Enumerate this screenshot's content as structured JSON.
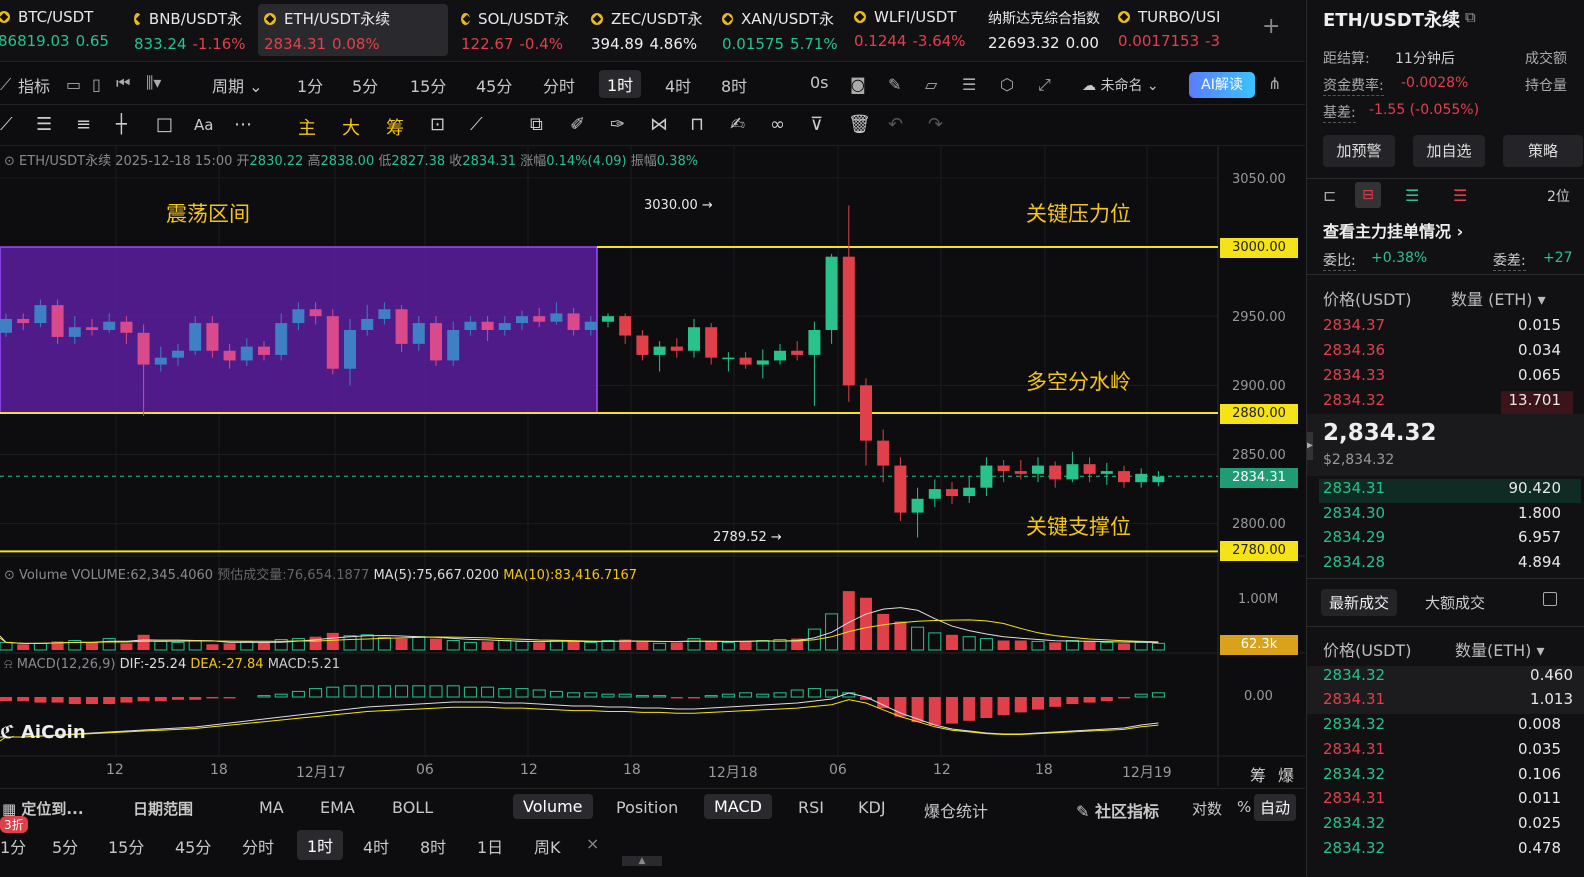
{
  "tickers": [
    {
      "symbol": "BTC/USDT",
      "price": "86819.03",
      "change": "0.65",
      "color": "green"
    },
    {
      "symbol": "BNB/USDT永",
      "price": "833.24",
      "change": "-1.16%",
      "color": "green"
    },
    {
      "symbol": "ETH/USDT永续",
      "price": "2834.31",
      "change": "0.08%",
      "color": "red"
    },
    {
      "symbol": "SOL/USDT永",
      "price": "122.67",
      "change": "-0.4%",
      "color": "red"
    },
    {
      "symbol": "ZEC/USDT永",
      "price": "394.89",
      "change": "4.86%",
      "color": "white"
    },
    {
      "symbol": "XAN/USDT永",
      "price": "0.01575",
      "change": "5.71%",
      "color": "green"
    },
    {
      "symbol": "WLFI/USDT",
      "price": "0.1244",
      "change": "-3.64%",
      "color": "red"
    },
    {
      "symbol": "纳斯达克综合指数",
      "price": "22693.32",
      "change": "0.00",
      "color": "white"
    },
    {
      "symbol": "TURBO/USI",
      "price": "0.0017153",
      "change": "-3",
      "color": "red"
    }
  ],
  "toolbar": {
    "indicators": "指标",
    "period": "周期",
    "intervals": [
      "1分",
      "5分",
      "15分",
      "45分",
      "分时",
      "1时",
      "4时",
      "8时"
    ],
    "selected_interval": "1时",
    "countdown": "0s",
    "layout_name": "未命名",
    "ai_label": "AI解读"
  },
  "drawing_tools": {
    "main": "主",
    "big": "大",
    "chips": "筹"
  },
  "ohlc": {
    "symbol": "ETH/USDT永续",
    "datetime": "2025-12-18 15:00",
    "open_label": "开",
    "open": "2830.22",
    "high_label": "高",
    "high": "2838.00",
    "low_label": "低",
    "low": "2827.38",
    "close_label": "收",
    "close": "2834.31",
    "change_label": "涨幅",
    "change": "0.14%(4.09)",
    "amp_label": "振幅",
    "amp": "0.38%"
  },
  "annotations": {
    "range": "震荡区间",
    "resistance": "关键压力位",
    "watershed": "多空分水岭",
    "support": "关键支撑位",
    "high_mark": "3030.00 →",
    "low_mark": "2789.52 →"
  },
  "price_axis": [
    "3050.00",
    "3000.00",
    "2950.00",
    "2900.00",
    "2880.00",
    "2850.00",
    "2834.31",
    "2800.00",
    "2780.00"
  ],
  "price_tags": {
    "p3000": "3000.00",
    "p2880": "2880.00",
    "current": "2834.31",
    "p2780": "2780.00"
  },
  "volume": {
    "label": "Volume",
    "value": "VOLUME:62,345.4060",
    "est": "预估成交量:76,654.1877",
    "ma5": "MA(5):75,667.0200",
    "ma10": "MA(10):83,416.7167",
    "axis": "1.00M",
    "tag": "62.3k"
  },
  "macd": {
    "label": "MACD(12,26,9)",
    "dif": "DIF:-25.24",
    "dea": "DEA:-27.84",
    "macd": "MACD:5.21",
    "axis": "0.00",
    "brand": "AiCoin"
  },
  "time_axis": [
    "12",
    "18",
    "12月17",
    "06",
    "12",
    "18",
    "12月18",
    "06",
    "12",
    "18",
    "12月19"
  ],
  "time_axis_right": {
    "chips": "筹",
    "liq": "爆"
  },
  "bottom1": {
    "locate": "定位到...",
    "date_range": "日期范围",
    "ma": "MA",
    "ema": "EMA",
    "boll": "BOLL",
    "volume": "Volume",
    "position": "Position",
    "macd": "MACD",
    "rsi": "RSI",
    "kdj": "KDJ",
    "liq_stats": "爆仓统计",
    "community": "社区指标",
    "log": "对数",
    "pct": "%",
    "auto": "自动"
  },
  "bottom2": {
    "badge": "3折",
    "intervals": [
      "1分",
      "5分",
      "15分",
      "45分",
      "分时",
      "1时",
      "4时",
      "8时",
      "1日",
      "周K"
    ],
    "selected": "1时"
  },
  "right_panel": {
    "title": "ETH/USDT永续",
    "settle_label": "距结算:",
    "settle": "11分钟后",
    "turnover_label": "成交额",
    "funding_label": "资金费率:",
    "funding": "-0.0028%",
    "oi_label": "持仓量",
    "basis_label": "基差:",
    "basis": "-1.55 (-0.055%)",
    "buttons": [
      "加预警",
      "加自选",
      "策略"
    ],
    "depth_label": "2位",
    "main_orders": "查看主力挂单情况",
    "ratio_label": "委比:",
    "ratio": "+0.38%",
    "diff_label": "委差:",
    "diff": "+27",
    "price_header": "价格(USDT)",
    "qty_header": "数量 (ETH)",
    "asks": [
      {
        "p": "2834.37",
        "q": "0.015"
      },
      {
        "p": "2834.36",
        "q": "0.034"
      },
      {
        "p": "2834.33",
        "q": "0.065"
      },
      {
        "p": "2834.32",
        "q": "13.701"
      }
    ],
    "last_price": "2,834.32",
    "last_usd": "$2,834.32",
    "bids": [
      {
        "p": "2834.31",
        "q": "90.420"
      },
      {
        "p": "2834.30",
        "q": "1.800"
      },
      {
        "p": "2834.29",
        "q": "6.957"
      },
      {
        "p": "2834.28",
        "q": "4.894"
      }
    ],
    "trades_tab": "最新成交",
    "big_trades_tab": "大额成交",
    "trades_price_header": "价格(USDT)",
    "trades_qty_header": "数量(ETH)",
    "trades": [
      {
        "p": "2834.32",
        "q": "0.460",
        "side": "buy"
      },
      {
        "p": "2834.31",
        "q": "1.013",
        "side": "sell"
      },
      {
        "p": "2834.32",
        "q": "0.008",
        "side": "buy"
      },
      {
        "p": "2834.31",
        "q": "0.035",
        "side": "sell"
      },
      {
        "p": "2834.32",
        "q": "0.106",
        "side": "buy"
      },
      {
        "p": "2834.31",
        "q": "0.011",
        "side": "sell"
      },
      {
        "p": "2834.32",
        "q": "0.025",
        "side": "buy"
      },
      {
        "p": "2834.32",
        "q": "0.478",
        "side": "buy"
      }
    ]
  },
  "colors": {
    "up": "#28c28a",
    "down": "#e0404a",
    "level": "#f5e318",
    "range_box": "#5a1f9e",
    "blue": "#3f7fc4"
  }
}
